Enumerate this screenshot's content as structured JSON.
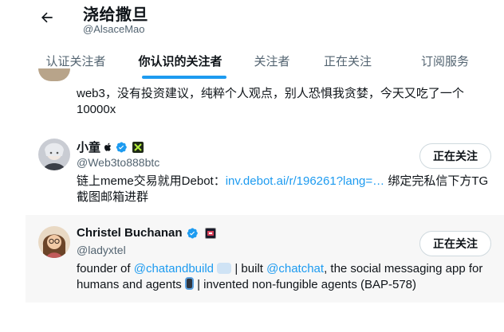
{
  "header": {
    "title": "浇给撒旦",
    "handle": "@AlsaceMao"
  },
  "tabs": [
    {
      "label": "认证关注者"
    },
    {
      "label": "你认识的关注者"
    },
    {
      "label": "关注者"
    },
    {
      "label": "正在关注"
    },
    {
      "label": "订阅服务"
    }
  ],
  "partial_post": {
    "text": "web3，没有投资建议，纯粹个人观点，别人恐惧我贪婪，今天又吃了一个10000x"
  },
  "users": [
    {
      "name": "小童",
      "handle": "@Web3to888btc",
      "bio_prefix": "链上meme交易就用Debot：",
      "bio_link": "inv.debot.ai/r/196261?lang=…",
      "bio_suffix": " 绑定完私信下方TG截图邮箱进群",
      "button": "正在关注"
    },
    {
      "name": "Christel Buchanan",
      "handle": "@ladyxtel",
      "bio_1": "founder of ",
      "bio_link_1": "@chatandbuild",
      "bio_2": " | built ",
      "bio_link_2": "@chatchat",
      "bio_3": ", the social messaging app for humans and agents ",
      "bio_4": " | invented non-fungible agents (BAP-578)",
      "button": "正在关注"
    }
  ],
  "icons": {
    "back": "arrow-left-icon",
    "verified": "verified-badge-icon",
    "apple": "apple-icon"
  },
  "colors": {
    "accent": "#1d9bf0",
    "text": "#0f1419",
    "secondary": "#536471"
  }
}
